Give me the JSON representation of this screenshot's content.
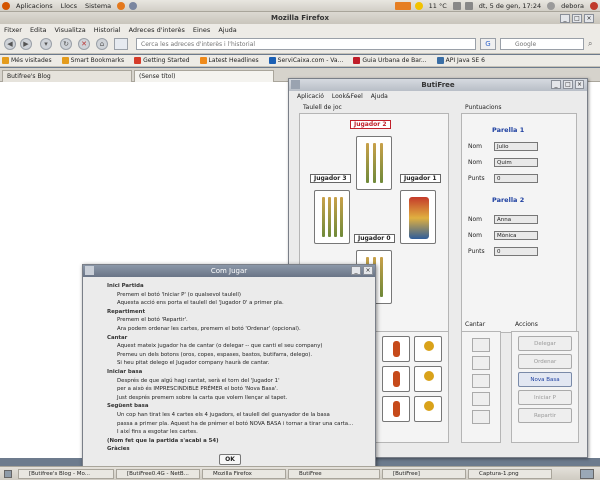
{
  "panel": {
    "menus": [
      "Aplicacions",
      "Llocs",
      "Sistema"
    ],
    "weather": "11 °C",
    "clock": "dt, 5 de gen, 17:24",
    "user": "debora"
  },
  "firefox": {
    "title": "Mozilla Firefox",
    "menus": [
      "Fitxer",
      "Edita",
      "Visualitza",
      "Historial",
      "Adreces d'interès",
      "Eines",
      "Ajuda"
    ],
    "url_placeholder": "Cerca les adreces d'interès i l'historial",
    "search_placeholder": "Google",
    "bookmarks": [
      "Més visitades",
      "Smart Bookmarks",
      "Getting Started",
      "Latest Headlines",
      "ServiCaixa.com - Va...",
      "Guia Urbana de Bar...",
      "API Java SE 6"
    ],
    "tabs": [
      "Butifree's Blog",
      "(Sense títol)"
    ]
  },
  "butifree": {
    "title": "ButiFree",
    "menus": [
      "Aplicació",
      "Look&Feel",
      "Ajuda"
    ],
    "table_title": "Taulell de joc",
    "players": {
      "p2": "Jugador 2",
      "p3": "Jugador 3",
      "p1": "Jugador 1",
      "p0": "Jugador 0"
    },
    "scores_title": "Puntuacions",
    "pair1": {
      "title": "Parella 1",
      "nom_label": "Nom",
      "punts_label": "Punts",
      "name1": "Julio",
      "name2": "Quim",
      "points": "0"
    },
    "pair2": {
      "title": "Parella 2",
      "nom_label": "Nom",
      "punts_label": "Punts",
      "name1": "Anna",
      "name2": "Mònica",
      "points": "0"
    },
    "cantar_title": "Cantar",
    "accions_title": "Accions",
    "actions": [
      "Delegar",
      "Ordenar",
      "Nova Basa",
      "Iniciar P",
      "Repartir"
    ]
  },
  "dialog": {
    "title": "Com Jugar",
    "lines": [
      {
        "style": "h",
        "text": "Inici Partida"
      },
      {
        "style": "t",
        "text": "Premem el botó 'Iniciar P' (o qualsevol taulell)"
      },
      {
        "style": "t",
        "text": "Aquesta acció ens porta el taulell del 'Jugador 0' a primer pla."
      },
      {
        "style": "h",
        "text": "Repartiment"
      },
      {
        "style": "t",
        "text": "Premem el botó 'Repartir'."
      },
      {
        "style": "t",
        "text": "Ara podem ordenar les cartes, premem el botó 'Ordenar' (opcional)."
      },
      {
        "style": "h",
        "text": "Cantar"
      },
      {
        "style": "t",
        "text": "Aquest mateix jugador ha de cantar (o delegar -- que canti el seu company)"
      },
      {
        "style": "t",
        "text": "Premeu un dels botons (oros, copes, espases, bastos, butifarra, delego)."
      },
      {
        "style": "t",
        "text": "Si heu pitat delego el Jugador company haurà de cantar."
      },
      {
        "style": "h",
        "text": "Iniciar basa"
      },
      {
        "style": "t",
        "text": "Després de que algú hagi cantat, serà el torn del 'Jugador 1'"
      },
      {
        "style": "t",
        "text": "per a això és IMPRESCINDIBLE PRÉMER el botó 'Nova Basa'."
      },
      {
        "style": "t",
        "text": "Just després premem sobre la carta que volem llençar al tapet."
      },
      {
        "style": "h",
        "text": "Següent basa"
      },
      {
        "style": "t",
        "text": "Un cop han tirat les 4 cartes els 4 jugadors, el taulell del guanyador de la basa"
      },
      {
        "style": "t",
        "text": "passa a primer pla. Aquest ha de prémer el botó NOVA BASA i tornar a tirar una carta..."
      },
      {
        "style": "t",
        "text": "I així fins a esgotar les cartes."
      },
      {
        "style": "h",
        "text": "(Nom fet que la partida s'acabi a 54)"
      },
      {
        "style": "h",
        "text": "Gràcies"
      }
    ],
    "ok": "OK"
  },
  "taskbar": [
    "[Butifree's Blog - Mo...",
    "[ButiFree0.4G - NetB...",
    "Mozilla Firefox",
    "ButiFree",
    "[ButiFree]",
    "Captura-1.png"
  ]
}
